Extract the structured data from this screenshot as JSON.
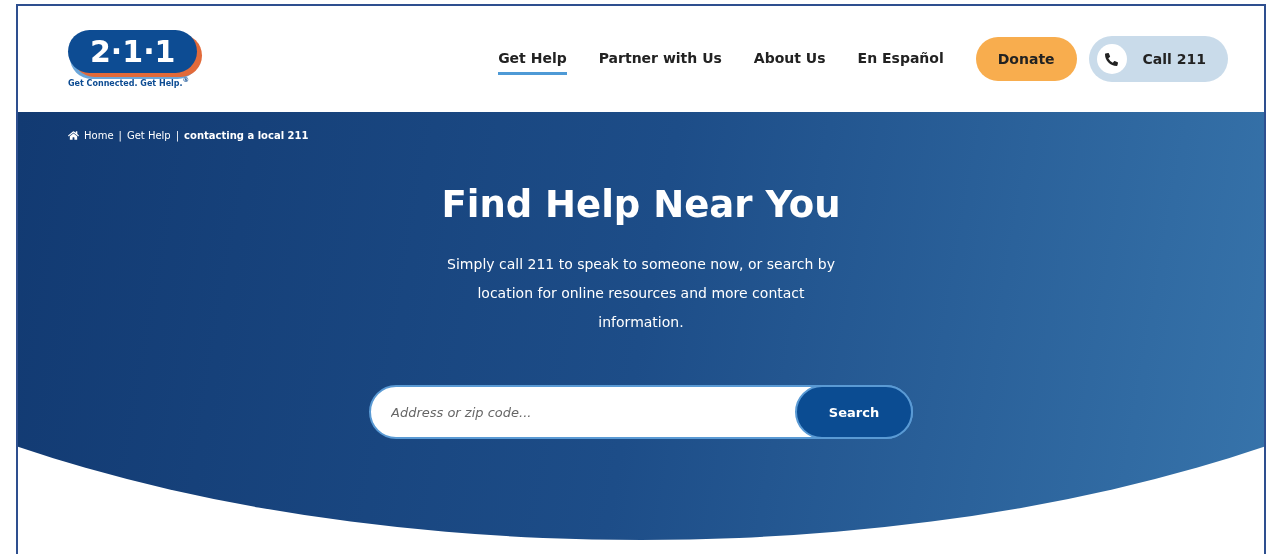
{
  "logo": {
    "mark": "2·1·1",
    "tagline": "Get Connected. Get Help.$^{®}$"
  },
  "nav": [
    {
      "label": "Get Help",
      "selected": true
    },
    {
      "label": "Partner with Us",
      "selected": false
    },
    {
      "label": "About Us",
      "selected": false
    },
    {
      "label": "En Español",
      "selected": false
    }
  ],
  "donate_button": "Donate",
  "call_button": "Call 211",
  "breadcrumb_separator": "|",
  "breadcrumb": [
    {
      "label": "Home",
      "current": false
    },
    {
      "label": "Get Help",
      "current": false
    },
    {
      "label": "contacting a local 211",
      "current": true
    }
  ],
  "hero": {
    "title": "Find Help Near You",
    "text": "Simply call 211 to speak to someone now, or search by location for online resources and more contact information."
  },
  "search": {
    "placeholder": "Address or zip code...",
    "button": "Search"
  }
}
